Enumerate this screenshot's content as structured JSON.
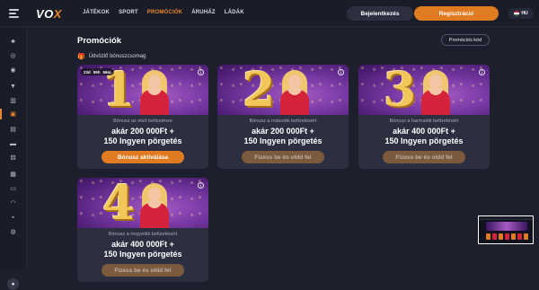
{
  "header": {
    "logo": {
      "text": "VO",
      "accent": "X"
    },
    "nav": [
      {
        "label": "JÁTÉKOK",
        "active": false
      },
      {
        "label": "SPORT",
        "active": false
      },
      {
        "label": "PROMÓCIÓK",
        "active": true
      },
      {
        "label": "ÁRUHÁZ",
        "active": false
      },
      {
        "label": "LÁDÁK",
        "active": false
      }
    ],
    "login_label": "Bejelentkezés",
    "register_label": "Regisztráció",
    "language": "HU"
  },
  "sidebar": {
    "icons": [
      "cards-icon",
      "target-icon",
      "live-icon",
      "gift-icon",
      "trophy-icon",
      "city-icon",
      "cards-stack-icon",
      "ticket-icon",
      "dice-icon",
      "slot-icon",
      "table-icon",
      "wifi-icon",
      "news-icon",
      "support-icon"
    ],
    "chat_icon": "chat-icon"
  },
  "main": {
    "title": "Promóciók",
    "promo_code_label": "Promóciós kód",
    "section_title": "Üdvözlő bónuszcsomag"
  },
  "cards": [
    {
      "number": "1",
      "timer": [
        "23d",
        "59h",
        "56m"
      ],
      "subtitle": "Bónusz az első befizetésre",
      "line1": "akár 200 000Ft +",
      "line2": "150 Ingyen pörgetés",
      "cta": "Bónusz aktiválása",
      "cta_state": "primary"
    },
    {
      "number": "2",
      "subtitle": "Bónusz a második befizetésért",
      "line1": "akár 200 000Ft +",
      "line2": "150 Ingyen pörgetés",
      "cta": "Fizess be és oldd fel",
      "cta_state": "muted"
    },
    {
      "number": "3",
      "subtitle": "Bónusz a harmadik befizetésért",
      "line1": "akár 400 000Ft +",
      "line2": "150 Ingyen pörgetés",
      "cta": "Fizess be és oldd fel",
      "cta_state": "muted"
    },
    {
      "number": "4",
      "subtitle": "Bónusz a negyedik befizetésért",
      "line1": "akár 400 000Ft +",
      "line2": "150 Ingyen pörgetés",
      "cta": "Fizess be és oldd fel",
      "cta_state": "muted"
    }
  ],
  "colors": {
    "accent": "#e07b22",
    "background": "#1d1f2c",
    "card": "#2c2f40",
    "banner": "#7a3aa5"
  }
}
